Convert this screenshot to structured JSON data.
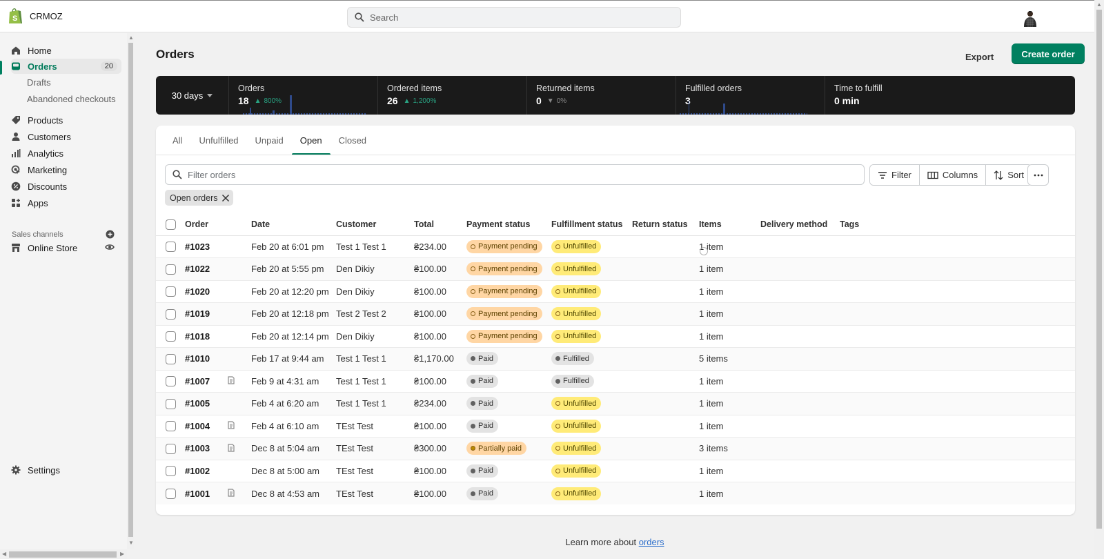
{
  "app": {
    "store_name": "CRMOZ",
    "search_placeholder": "Search"
  },
  "sidebar": {
    "items": [
      {
        "id": "home",
        "label": "Home",
        "icon": "home-icon"
      },
      {
        "id": "orders",
        "label": "Orders",
        "icon": "orders-icon",
        "count": "20",
        "active": true
      },
      {
        "id": "products",
        "label": "Products",
        "icon": "tag-icon"
      },
      {
        "id": "customers",
        "label": "Customers",
        "icon": "person-icon"
      },
      {
        "id": "analytics",
        "label": "Analytics",
        "icon": "bar-chart-icon"
      },
      {
        "id": "marketing",
        "label": "Marketing",
        "icon": "target-icon"
      },
      {
        "id": "discounts",
        "label": "Discounts",
        "icon": "discount-icon"
      },
      {
        "id": "apps",
        "label": "Apps",
        "icon": "apps-icon"
      }
    ],
    "order_subitems": [
      "Drafts",
      "Abandoned checkouts"
    ],
    "sales_channels_label": "Sales channels",
    "online_store_label": "Online Store",
    "settings_label": "Settings"
  },
  "page": {
    "title": "Orders",
    "export_label": "Export",
    "create_label": "Create order"
  },
  "metrics": {
    "range_label": "30 days",
    "cards": [
      {
        "label": "Orders",
        "value": "18",
        "delta": "800%",
        "trend": "up"
      },
      {
        "label": "Ordered items",
        "value": "26",
        "delta": "1,200%",
        "trend": "up"
      },
      {
        "label": "Returned items",
        "value": "0",
        "delta": "0%",
        "trend": "neutral"
      },
      {
        "label": "Fulfilled orders",
        "value": "3",
        "delta": "",
        "trend": "none"
      },
      {
        "label": "Time to fulfill",
        "value": "0 min",
        "delta": "",
        "trend": "none"
      }
    ]
  },
  "tabs": [
    {
      "label": "All",
      "active": false
    },
    {
      "label": "Unfulfilled",
      "active": false
    },
    {
      "label": "Unpaid",
      "active": false
    },
    {
      "label": "Open",
      "active": true
    },
    {
      "label": "Closed",
      "active": false
    }
  ],
  "filter": {
    "placeholder": "Filter orders",
    "filter_label": "Filter",
    "columns_label": "Columns",
    "sort_label": "Sort",
    "active_chip": "Open orders"
  },
  "table": {
    "columns": [
      "Order",
      "Date",
      "Customer",
      "Total",
      "Payment status",
      "Fulfillment status",
      "Return status",
      "Items",
      "Delivery method",
      "Tags"
    ],
    "rows": [
      {
        "order": "#1023",
        "note": false,
        "date": "Feb 20 at 6:01 pm",
        "customer": "Test 1 Test 1",
        "total": "₴234.00",
        "payment": "Payment pending",
        "payment_type": "pending",
        "fulfillment": "Unfulfilled",
        "fulfillment_type": "unfulfilled",
        "items": "1 item"
      },
      {
        "order": "#1022",
        "note": false,
        "date": "Feb 20 at 5:55 pm",
        "customer": "Den Dikiy",
        "total": "₴100.00",
        "payment": "Payment pending",
        "payment_type": "pending",
        "fulfillment": "Unfulfilled",
        "fulfillment_type": "unfulfilled",
        "items": "1 item"
      },
      {
        "order": "#1020",
        "note": false,
        "date": "Feb 20 at 12:20 pm",
        "customer": "Den Dikiy",
        "total": "₴100.00",
        "payment": "Payment pending",
        "payment_type": "pending",
        "fulfillment": "Unfulfilled",
        "fulfillment_type": "unfulfilled",
        "items": "1 item"
      },
      {
        "order": "#1019",
        "note": false,
        "date": "Feb 20 at 12:18 pm",
        "customer": "Test 2 Test 2",
        "total": "₴100.00",
        "payment": "Payment pending",
        "payment_type": "pending",
        "fulfillment": "Unfulfilled",
        "fulfillment_type": "unfulfilled",
        "items": "1 item"
      },
      {
        "order": "#1018",
        "note": false,
        "date": "Feb 20 at 12:14 pm",
        "customer": "Den Dikiy",
        "total": "₴100.00",
        "payment": "Payment pending",
        "payment_type": "pending",
        "fulfillment": "Unfulfilled",
        "fulfillment_type": "unfulfilled",
        "items": "1 item"
      },
      {
        "order": "#1010",
        "note": false,
        "date": "Feb 17 at 9:44 am",
        "customer": "Test 1 Test 1",
        "total": "₴1,170.00",
        "payment": "Paid",
        "payment_type": "paid",
        "fulfillment": "Fulfilled",
        "fulfillment_type": "fulfilled",
        "items": "5 items"
      },
      {
        "order": "#1007",
        "note": true,
        "date": "Feb 9 at 4:31 am",
        "customer": "Test 1 Test 1",
        "total": "₴100.00",
        "payment": "Paid",
        "payment_type": "paid",
        "fulfillment": "Fulfilled",
        "fulfillment_type": "fulfilled",
        "items": "1 item"
      },
      {
        "order": "#1005",
        "note": false,
        "date": "Feb 4 at 6:20 am",
        "customer": "Test 1 Test 1",
        "total": "₴234.00",
        "payment": "Paid",
        "payment_type": "paid",
        "fulfillment": "Unfulfilled",
        "fulfillment_type": "unfulfilled",
        "items": "1 item"
      },
      {
        "order": "#1004",
        "note": true,
        "date": "Feb 4 at 6:10 am",
        "customer": "TEst Test",
        "total": "₴100.00",
        "payment": "Paid",
        "payment_type": "paid",
        "fulfillment": "Unfulfilled",
        "fulfillment_type": "unfulfilled",
        "items": "1 item"
      },
      {
        "order": "#1003",
        "note": true,
        "date": "Dec 8 at 5:04 am",
        "customer": "TEst Test",
        "total": "₴300.00",
        "payment": "Partially paid",
        "payment_type": "partial",
        "fulfillment": "Unfulfilled",
        "fulfillment_type": "unfulfilled",
        "items": "3 items"
      },
      {
        "order": "#1002",
        "note": false,
        "date": "Dec 8 at 5:00 am",
        "customer": "TEst Test",
        "total": "₴100.00",
        "payment": "Paid",
        "payment_type": "paid",
        "fulfillment": "Unfulfilled",
        "fulfillment_type": "unfulfilled",
        "items": "1 item"
      },
      {
        "order": "#1001",
        "note": true,
        "date": "Dec 8 at 4:53 am",
        "customer": "TEst Test",
        "total": "₴100.00",
        "payment": "Paid",
        "payment_type": "paid",
        "fulfillment": "Unfulfilled",
        "fulfillment_type": "unfulfilled",
        "items": "1 item"
      }
    ]
  },
  "footer": {
    "learn_prefix": "Learn more about ",
    "learn_link": "orders"
  },
  "colors": {
    "brand": "#008060",
    "metrics_bg": "#1a1a1a",
    "delta_up": "#29a383",
    "link": "#2c6ecb"
  }
}
